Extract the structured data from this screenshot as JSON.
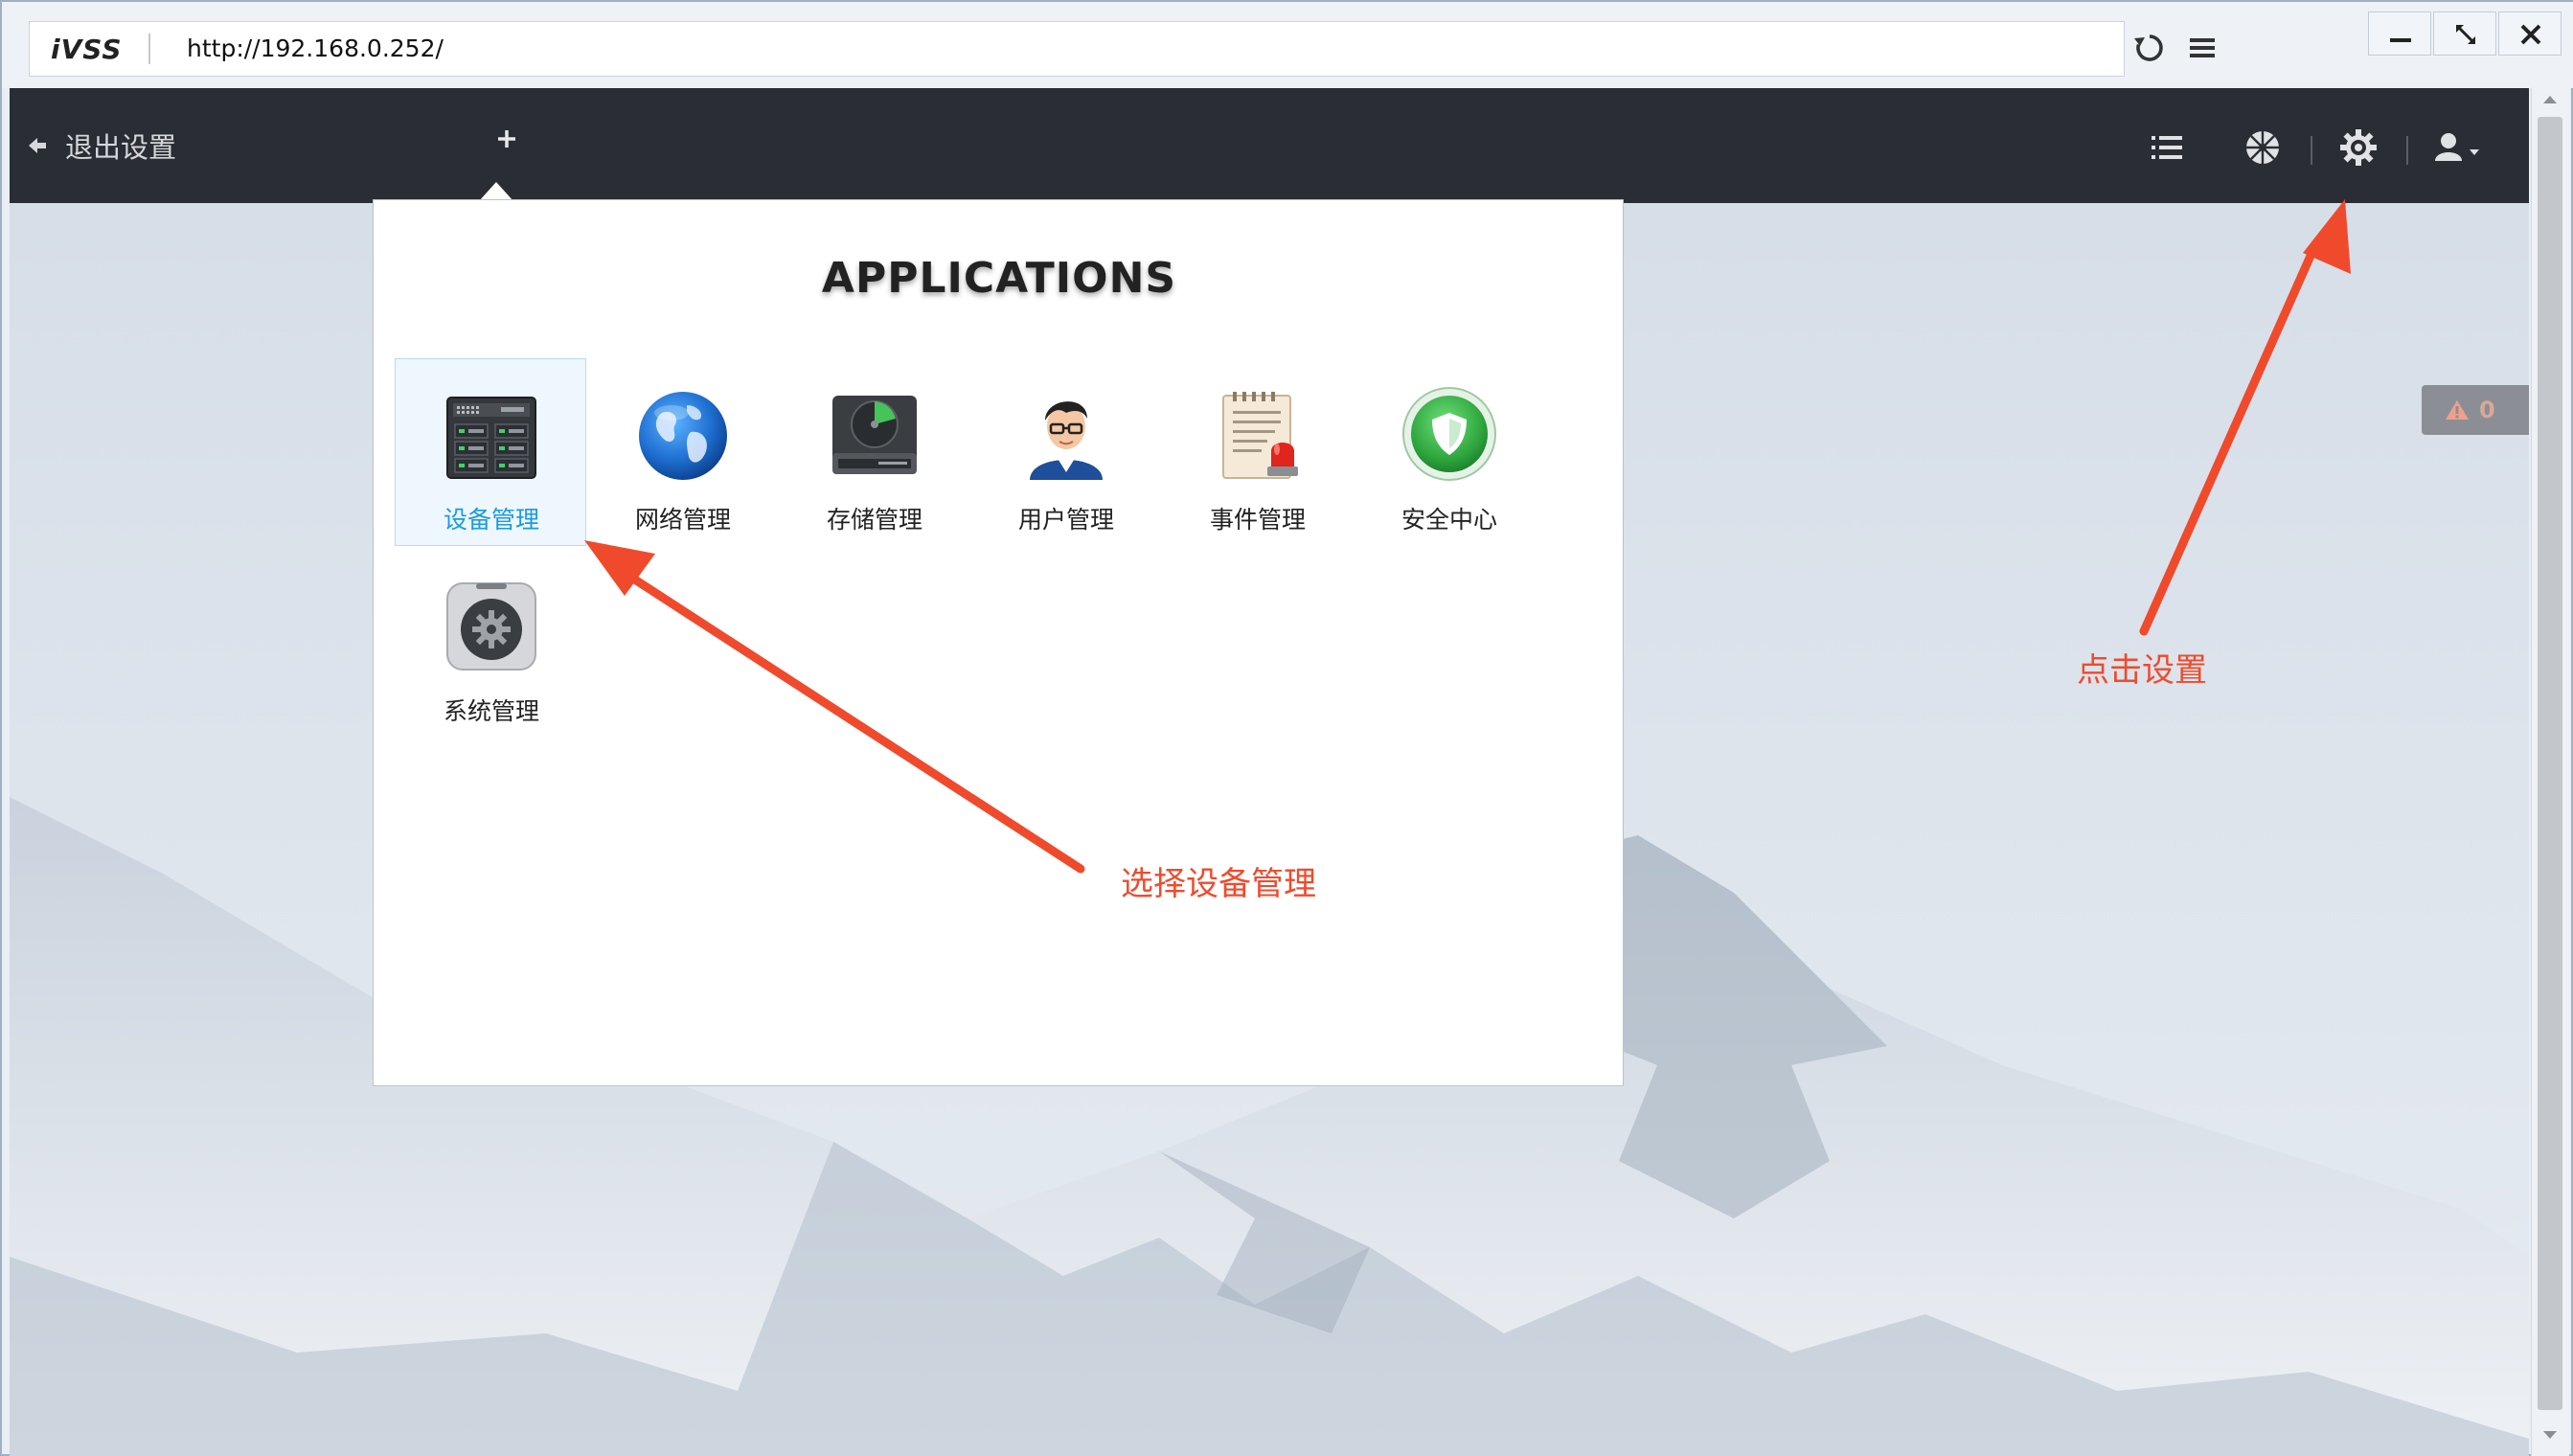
{
  "browser": {
    "brand": "iVSS",
    "url": "http://192.168.0.252/"
  },
  "toolbar": {
    "exit_label": "退出设置",
    "add_tab": "+"
  },
  "alarm": {
    "count": "0"
  },
  "apps_panel": {
    "title": "APPLICATIONS",
    "apps": [
      {
        "label": "设备管理",
        "icon": "device-icon",
        "selected": true
      },
      {
        "label": "网络管理",
        "icon": "globe-icon"
      },
      {
        "label": "存储管理",
        "icon": "storage-icon"
      },
      {
        "label": "用户管理",
        "icon": "user-icon"
      },
      {
        "label": "事件管理",
        "icon": "event-icon"
      },
      {
        "label": "安全中心",
        "icon": "shield-icon"
      },
      {
        "label": "系统管理",
        "icon": "system-icon"
      }
    ]
  },
  "annotations": {
    "select_device": "选择设备管理",
    "click_settings": "点击设置"
  },
  "colors": {
    "toolbar_bg": "#2a2d33",
    "accent": "#1a9be0",
    "annotation": "#f04a2c"
  }
}
